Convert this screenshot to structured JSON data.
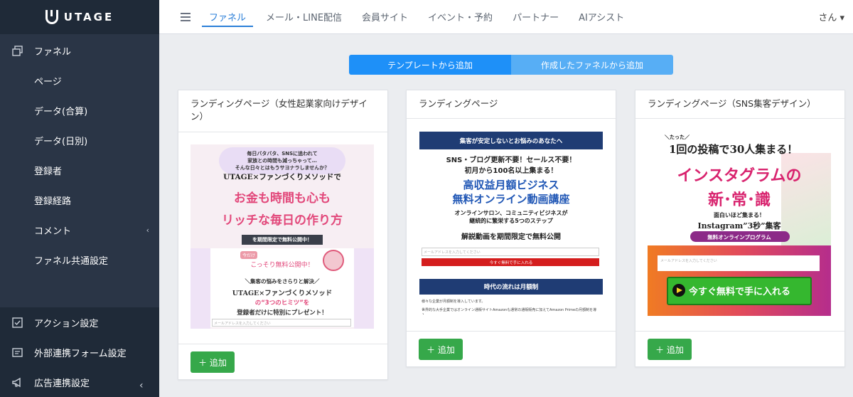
{
  "brand": {
    "name": "UTAGE"
  },
  "sidebar": {
    "items": [
      {
        "label": "ファネル"
      },
      {
        "label": "ページ"
      },
      {
        "label": "データ(合算)"
      },
      {
        "label": "データ(日別)"
      },
      {
        "label": "登録者"
      },
      {
        "label": "登録経路"
      },
      {
        "label": "コメント"
      },
      {
        "label": "ファネル共通設定"
      },
      {
        "label": "アクション設定"
      },
      {
        "label": "外部連携フォーム設定"
      },
      {
        "label": "広告連携設定"
      }
    ],
    "collapse": "‹",
    "comment_chevron": "‹"
  },
  "nav": {
    "tabs": [
      "ファネル",
      "メール・LINE配信",
      "会員サイト",
      "イベント・予約",
      "パートナー",
      "AIアシスト"
    ],
    "user": "さん ▾"
  },
  "segment": {
    "template": "テンプレートから追加",
    "created": "作成したファネルから追加"
  },
  "add_label": "＋ 追加",
  "cards": [
    {
      "title": "ランディングページ（女性起業家向けデザイン）",
      "preview": {
        "l1": "毎日バタバタ、SNSに追われて",
        "l2": "家族との時間も減っちゃって…",
        "l3": "そんな日々とはもうサヨナラしませんか？",
        "h1": "UTAGE×ファンづくりメソッドで",
        "h2": "お金も時間も心も",
        "h3": "リッチな毎日の作り方",
        "band": "を期間限定で無料公開中！",
        "p1": "今だけ",
        "p2": "こっそり無料公開中！",
        "p3": "＼集客の悩みをさらりと解決／",
        "p4": "UTAGE×ファンづくりメソッド",
        "p5": "の“3つのヒミツ”を",
        "p6": "登録者だけに特別にプレゼント！",
        "ph": "メールアドレスを入力してください"
      }
    },
    {
      "title": "ランディングページ",
      "preview": {
        "band": "集客が安定しないとお悩みのあなたへ",
        "l1": "SNS・ブログ更新不要！セールス不要！",
        "l2": "初月から100名以上集まる！",
        "h1": "高収益月額ビジネス",
        "h2": "無料オンライン動画講座",
        "s1": "オンラインサロン、コミュニティビジネスが",
        "s2": "継続的に繁栄する5つのステップ",
        "s3": "解説動画を期間限定で無料公開",
        "ph": "メールアドレスを入力してください",
        "btn": "今すぐ無料で手に入れる",
        "band2": "時代の流れは月額制",
        "t1": "様々な企業が月額制を導入しています。",
        "t2": "世界的な大手企業ではオンライン通販サイトAmazonも通常の通販販売に加えてAmazon Primeの月額制を導入。"
      }
    },
    {
      "title": "ランディングページ（SNS集客デザイン）",
      "preview": {
        "l0": "＼たった／",
        "h1": "1回の投稿で30人集まる！",
        "h2": "インスタグラムの",
        "h3": "新･常･識",
        "s1": "面白いほど集まる！",
        "s2": "Instagram”3秒”集客",
        "pill": "無料オンラインプログラム",
        "ph": "メールアドレスを入力してください",
        "btn": "今すぐ無料で手に入れる"
      }
    }
  ]
}
